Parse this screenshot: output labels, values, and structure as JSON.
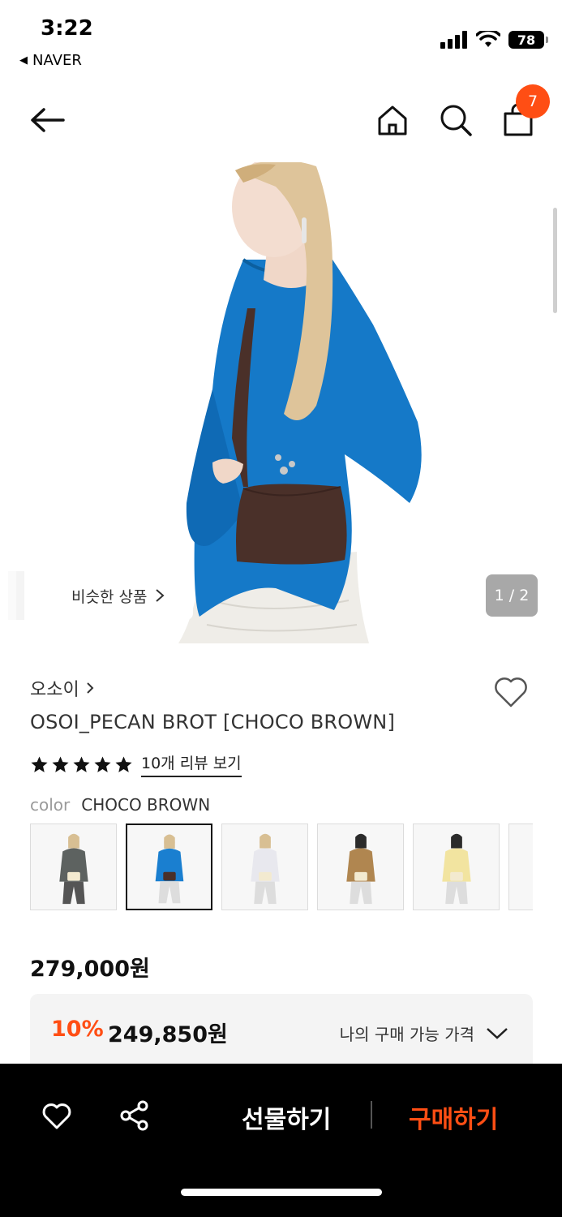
{
  "status_bar": {
    "time": "3:22",
    "back_app": "NAVER",
    "battery": "78"
  },
  "nav": {
    "cart_count": "7"
  },
  "hero": {
    "similar_label": "비슷한 상품",
    "page_indicator": "1 / 2"
  },
  "product": {
    "brand": "오소이",
    "name": "OSOI_PECAN BROT [CHOCO BROWN]",
    "rating_stars": 5,
    "review_link": "10개 리뷰 보기",
    "color_label": "color",
    "color_value": "CHOCO BROWN",
    "swatch_colors": [
      "#5d6260",
      "#1a7fd0",
      "#e8e8ee",
      "#b08650",
      "#f2e4a0",
      "#eeeeee"
    ],
    "selected_swatch": 1
  },
  "price": {
    "original": "279,000원",
    "discount_pct": "10%",
    "discount_price": "249,850원",
    "my_price_label": "나의 구매 가능 가격"
  },
  "bottom_bar": {
    "gift_label": "선물하기",
    "buy_label": "구매하기"
  },
  "colors": {
    "accent": "#ff4e14",
    "hoodie": "#1579c8",
    "bag": "#4a3029"
  }
}
